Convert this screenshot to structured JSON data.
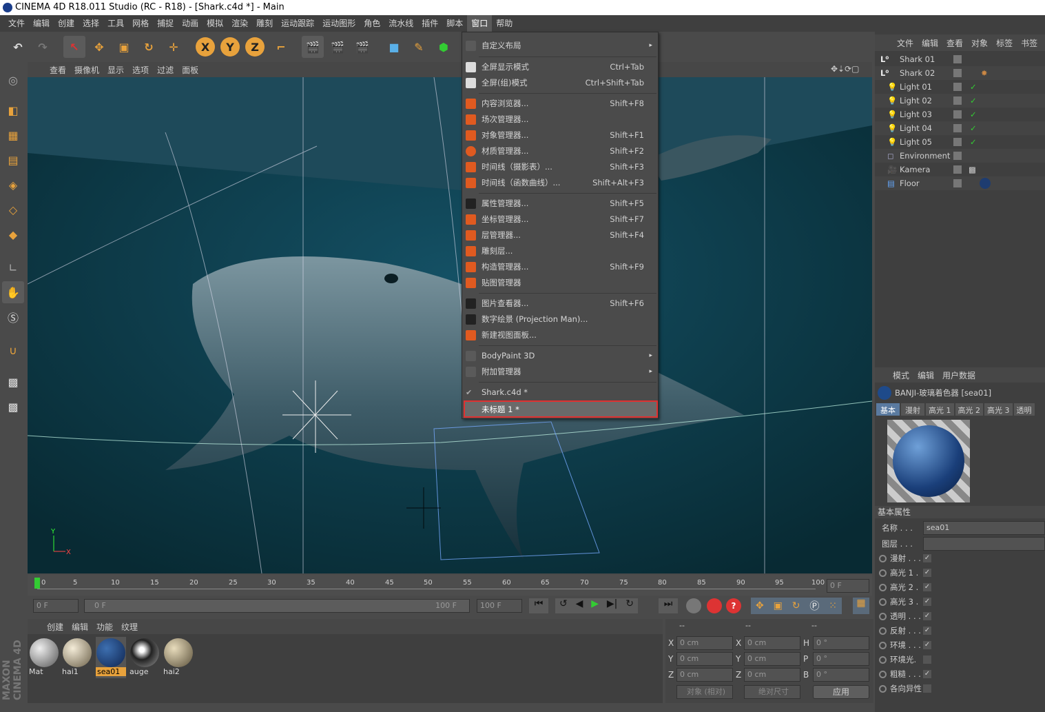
{
  "window": {
    "title": "CINEMA 4D R18.011 Studio (RC - R18) - [Shark.c4d *] - Main"
  },
  "menubar": [
    "文件",
    "编辑",
    "创建",
    "选择",
    "工具",
    "网格",
    "捕捉",
    "动画",
    "模拟",
    "渲染",
    "雕刻",
    "运动跟踪",
    "运动图形",
    "角色",
    "流水线",
    "插件",
    "脚本",
    "窗口",
    "帮助"
  ],
  "viewport_menu": [
    "查看",
    "摄像机",
    "显示",
    "选项",
    "过滤",
    "面板"
  ],
  "window_menu": {
    "items": [
      {
        "label": "自定义布局",
        "shortcut": "",
        "arrow": "▸"
      },
      {
        "label": "全屏显示模式",
        "shortcut": "Ctrl+Tab"
      },
      {
        "label": "全屏(组)模式",
        "shortcut": "Ctrl+Shift+Tab"
      },
      {
        "label": "内容浏览器...",
        "shortcut": "Shift+F8"
      },
      {
        "label": "场次管理器...",
        "shortcut": ""
      },
      {
        "label": "对象管理器...",
        "shortcut": "Shift+F1"
      },
      {
        "label": "材质管理器...",
        "shortcut": "Shift+F2"
      },
      {
        "label": "时间线（摄影表）...",
        "shortcut": "Shift+F3"
      },
      {
        "label": "时间线（函数曲线）...",
        "shortcut": "Shift+Alt+F3"
      },
      {
        "label": "属性管理器...",
        "shortcut": "Shift+F5"
      },
      {
        "label": "坐标管理器...",
        "shortcut": "Shift+F7"
      },
      {
        "label": "层管理器...",
        "shortcut": "Shift+F4"
      },
      {
        "label": "雕刻层...",
        "shortcut": ""
      },
      {
        "label": "构造管理器...",
        "shortcut": "Shift+F9"
      },
      {
        "label": "贴图管理器",
        "shortcut": ""
      },
      {
        "label": "图片查看器...",
        "shortcut": "Shift+F6"
      },
      {
        "label": "数字绘景 (Projection Man)...",
        "shortcut": ""
      },
      {
        "label": "新建视图面板...",
        "shortcut": ""
      },
      {
        "label": "BodyPaint 3D",
        "shortcut": "",
        "arrow": "▸"
      },
      {
        "label": "附加管理器",
        "shortcut": "",
        "arrow": "▸"
      },
      {
        "label": "Shark.c4d *",
        "shortcut": ""
      },
      {
        "label": "未标题 1 *",
        "shortcut": ""
      }
    ]
  },
  "object_manager": {
    "menu": [
      "文件",
      "编辑",
      "查看",
      "对象",
      "标签",
      "书签"
    ],
    "objects": [
      "Shark 01",
      "Shark 02",
      "Light 01",
      "Light 02",
      "Light 03",
      "Light 04",
      "Light 05",
      "Environment",
      "Kamera",
      "Floor"
    ]
  },
  "attribute_manager": {
    "menu": [
      "模式",
      "编辑",
      "用户数据"
    ],
    "material_title": "BANJI-玻璃着色器 [sea01]",
    "tabs": [
      "基本",
      "漫射",
      "高光 1",
      "高光 2",
      "高光 3",
      "透明"
    ],
    "section": "基本属性",
    "name_label": "名称 . . .",
    "name_value": "sea01",
    "layer_label": "图层 . . .",
    "channels": [
      {
        "label": "漫射 . . .",
        "on": "✓"
      },
      {
        "label": "高光 1 .",
        "on": "✓"
      },
      {
        "label": "高光 2 .",
        "on": "✓"
      },
      {
        "label": "高光 3 .",
        "on": "✓"
      },
      {
        "label": "透明 . . .",
        "on": "✓"
      },
      {
        "label": "反射 . . .",
        "on": "✓"
      },
      {
        "label": "环境 . . .",
        "on": "✓"
      },
      {
        "label": "环境光.",
        "on": ""
      },
      {
        "label": "粗糙 . . .",
        "on": "✓"
      },
      {
        "label": "各向异性",
        "on": ""
      }
    ]
  },
  "timeline": {
    "ticks": [
      "0",
      "5",
      "10",
      "15",
      "20",
      "25",
      "30",
      "35",
      "40",
      "45",
      "50",
      "55",
      "60",
      "65",
      "70",
      "75",
      "80",
      "85",
      "90",
      "95",
      "100"
    ],
    "current_frame": "0 F",
    "start": "0 F",
    "range_start": "0 F",
    "range_end": "100 F",
    "end": "100 F"
  },
  "material_manager": {
    "menu": [
      "创建",
      "编辑",
      "功能",
      "纹理"
    ],
    "materials": [
      "Mat",
      "hai1",
      "sea01",
      "auge",
      "hai2"
    ],
    "selected": "sea01"
  },
  "coordinates": {
    "headers": [
      "--",
      "--",
      "--"
    ],
    "rows": [
      {
        "a": "X",
        "av": "0 cm",
        "b": "X",
        "bv": "0 cm",
        "c": "H",
        "cv": "0 °"
      },
      {
        "a": "Y",
        "av": "0 cm",
        "b": "Y",
        "bv": "0 cm",
        "c": "P",
        "cv": "0 °"
      },
      {
        "a": "Z",
        "av": "0 cm",
        "b": "Z",
        "bv": "0 cm",
        "c": "B",
        "cv": "0 °"
      }
    ],
    "mode1": "对象 (相对)",
    "mode2": "绝对尺寸",
    "apply": "应用"
  },
  "brand": "MAXON CINEMA 4D",
  "colors": {
    "accent": "#e8a23c",
    "highlight": "#e03030",
    "viewport": "#0b3540"
  }
}
